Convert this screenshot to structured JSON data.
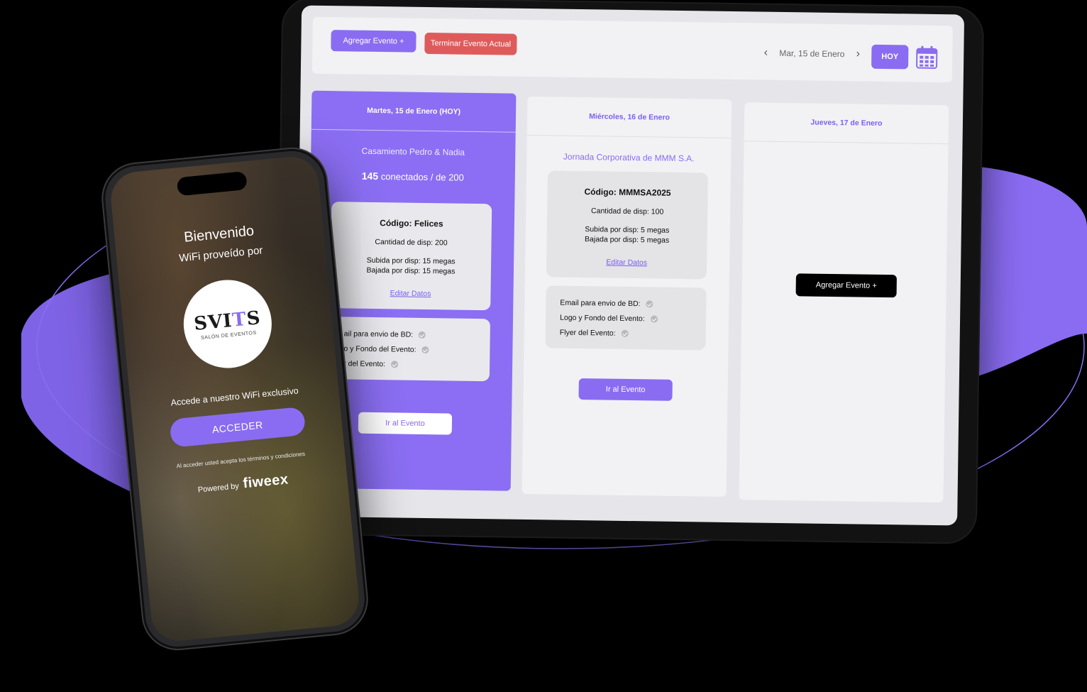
{
  "tablet": {
    "toolbar": {
      "add_event_label": "Agregar Evento +",
      "end_event_label": "Terminar Evento Actual",
      "current_date": "Mar, 15 de Enero",
      "today_label": "HOY"
    },
    "columns": [
      {
        "header": "Martes, 15 de Enero (HOY)",
        "event_name": "Casamiento Pedro & Nadia",
        "connected_count": "145",
        "connected_suffix": "conectados / de 200",
        "code_label": "Código:",
        "code_value": "Felices",
        "devices": "Cantidad de disp:  200",
        "upload": "Subida por disp:  15 megas",
        "download": "Bajada por disp:  15 megas",
        "edit_label": "Editar Datos",
        "checks": [
          "ail para envio de BD:",
          "o y Fondo del Evento:",
          "r del Evento:"
        ],
        "goto_label": "Ir al Evento"
      },
      {
        "header": "Miércoles, 16 de Enero",
        "event_name": "Jornada Corporativa de MMM S.A.",
        "code_label": "Código:",
        "code_value": "MMMSA2025",
        "devices": "Cantidad de disp:  100",
        "upload": "Subida por disp:  5 megas",
        "download": "Bajada por disp:  5 megas",
        "edit_label": "Editar Datos",
        "checks": [
          "Email para envio de BD:",
          "Logo y Fondo del Evento:",
          "Flyer del Evento:"
        ],
        "goto_label": "Ir al Evento"
      },
      {
        "header": "Jueves, 17 de Enero",
        "add_event_label": "Agregar Evento +"
      }
    ]
  },
  "phone": {
    "welcome": "Bienvenido",
    "wifi_by": "WiFi proveído por",
    "logo_main_a": "SVI",
    "logo_main_t": "T",
    "logo_main_b": "S",
    "logo_sub": "SALÓN DE EVENTOS",
    "access_text": "Accede a nuestro WiFi exclusivo",
    "access_button": "ACCEDER",
    "terms": "Al acceder usted acepta los términos y condiciones",
    "powered_by": "Powered by",
    "powered_brand": "fiweex"
  },
  "colors": {
    "accent": "#8a6cf2",
    "danger": "#df5b5b",
    "screen_bg": "#e5e5ea"
  }
}
